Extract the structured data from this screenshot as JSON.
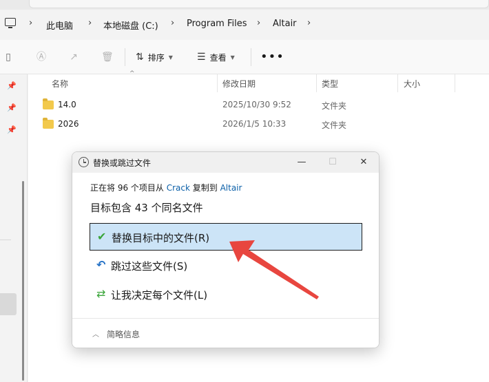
{
  "breadcrumb": {
    "items": [
      "此电脑",
      "本地磁盘 (C:)",
      "Program Files",
      "Altair"
    ]
  },
  "toolbar": {
    "sort_label": "排序",
    "view_label": "查看",
    "more_label": "•••"
  },
  "file_list": {
    "columns": [
      "名称",
      "修改日期",
      "类型",
      "大小"
    ],
    "rows": [
      {
        "name": "14.0",
        "date": "2025/10/30 9:52",
        "type": "文件夹"
      },
      {
        "name": "2026",
        "date": "2026/1/5 10:33",
        "type": "文件夹"
      }
    ]
  },
  "dialog": {
    "title": "替换或跳过文件",
    "copy_prefix": "正在将 96 个项目从 ",
    "source": "Crack",
    "copy_middle": " 复制到 ",
    "destination": "Altair",
    "conflict_text": "目标包含 43 个同名文件",
    "options": [
      {
        "label": "替换目标中的文件(R)",
        "icon": "check-icon"
      },
      {
        "label": "跳过这些文件(S)",
        "icon": "skip-icon"
      },
      {
        "label": "让我决定每个文件(L)",
        "icon": "decide-icon"
      }
    ],
    "details_label": "简略信息"
  },
  "colors": {
    "selected_option_bg": "#cce4f7",
    "link": "#0a5fa8",
    "annotation_arrow": "#e8463f"
  }
}
